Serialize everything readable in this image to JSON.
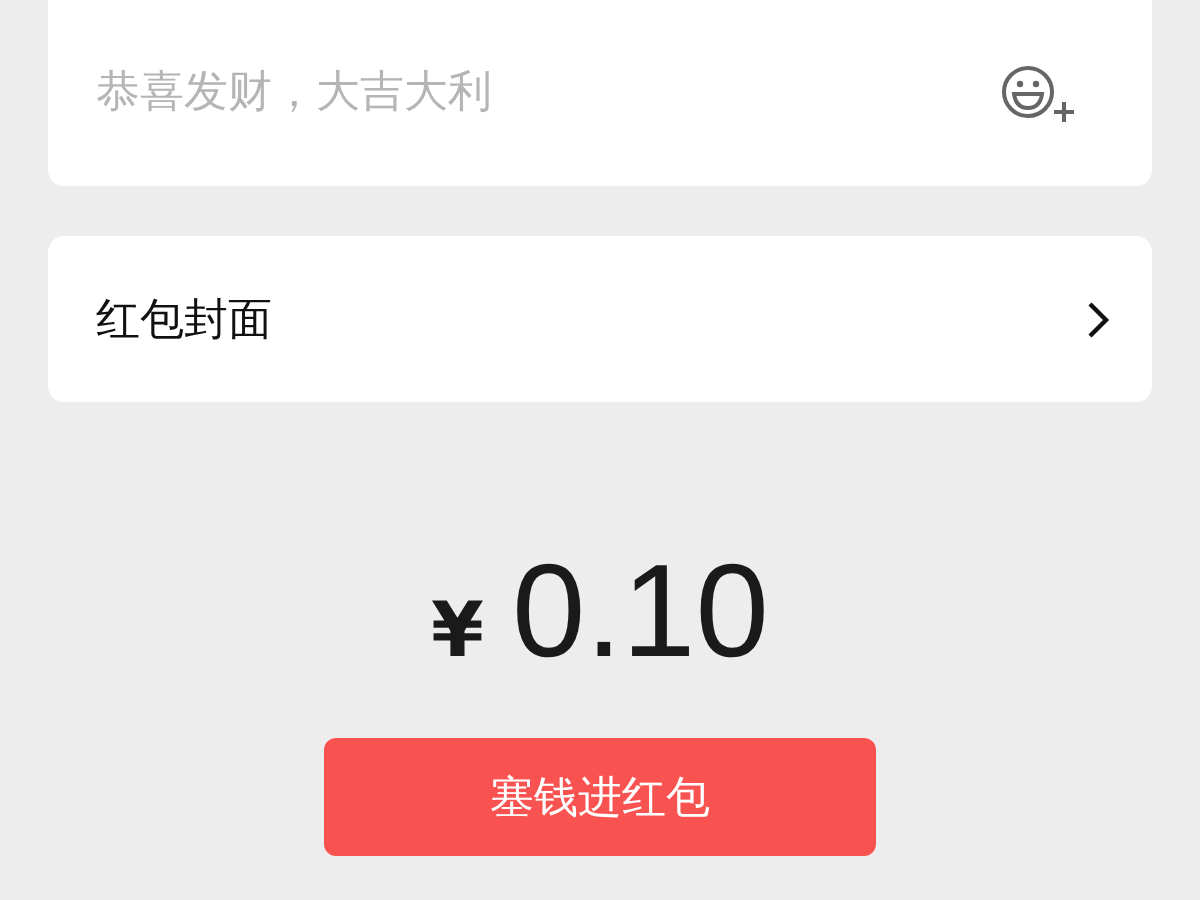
{
  "greeting_field": {
    "placeholder": "恭喜发财，大吉大利"
  },
  "cover_row": {
    "label": "红包封面"
  },
  "amount": {
    "currency": "¥",
    "value": "0.10"
  },
  "submit_button": {
    "label": "塞钱进红包"
  }
}
